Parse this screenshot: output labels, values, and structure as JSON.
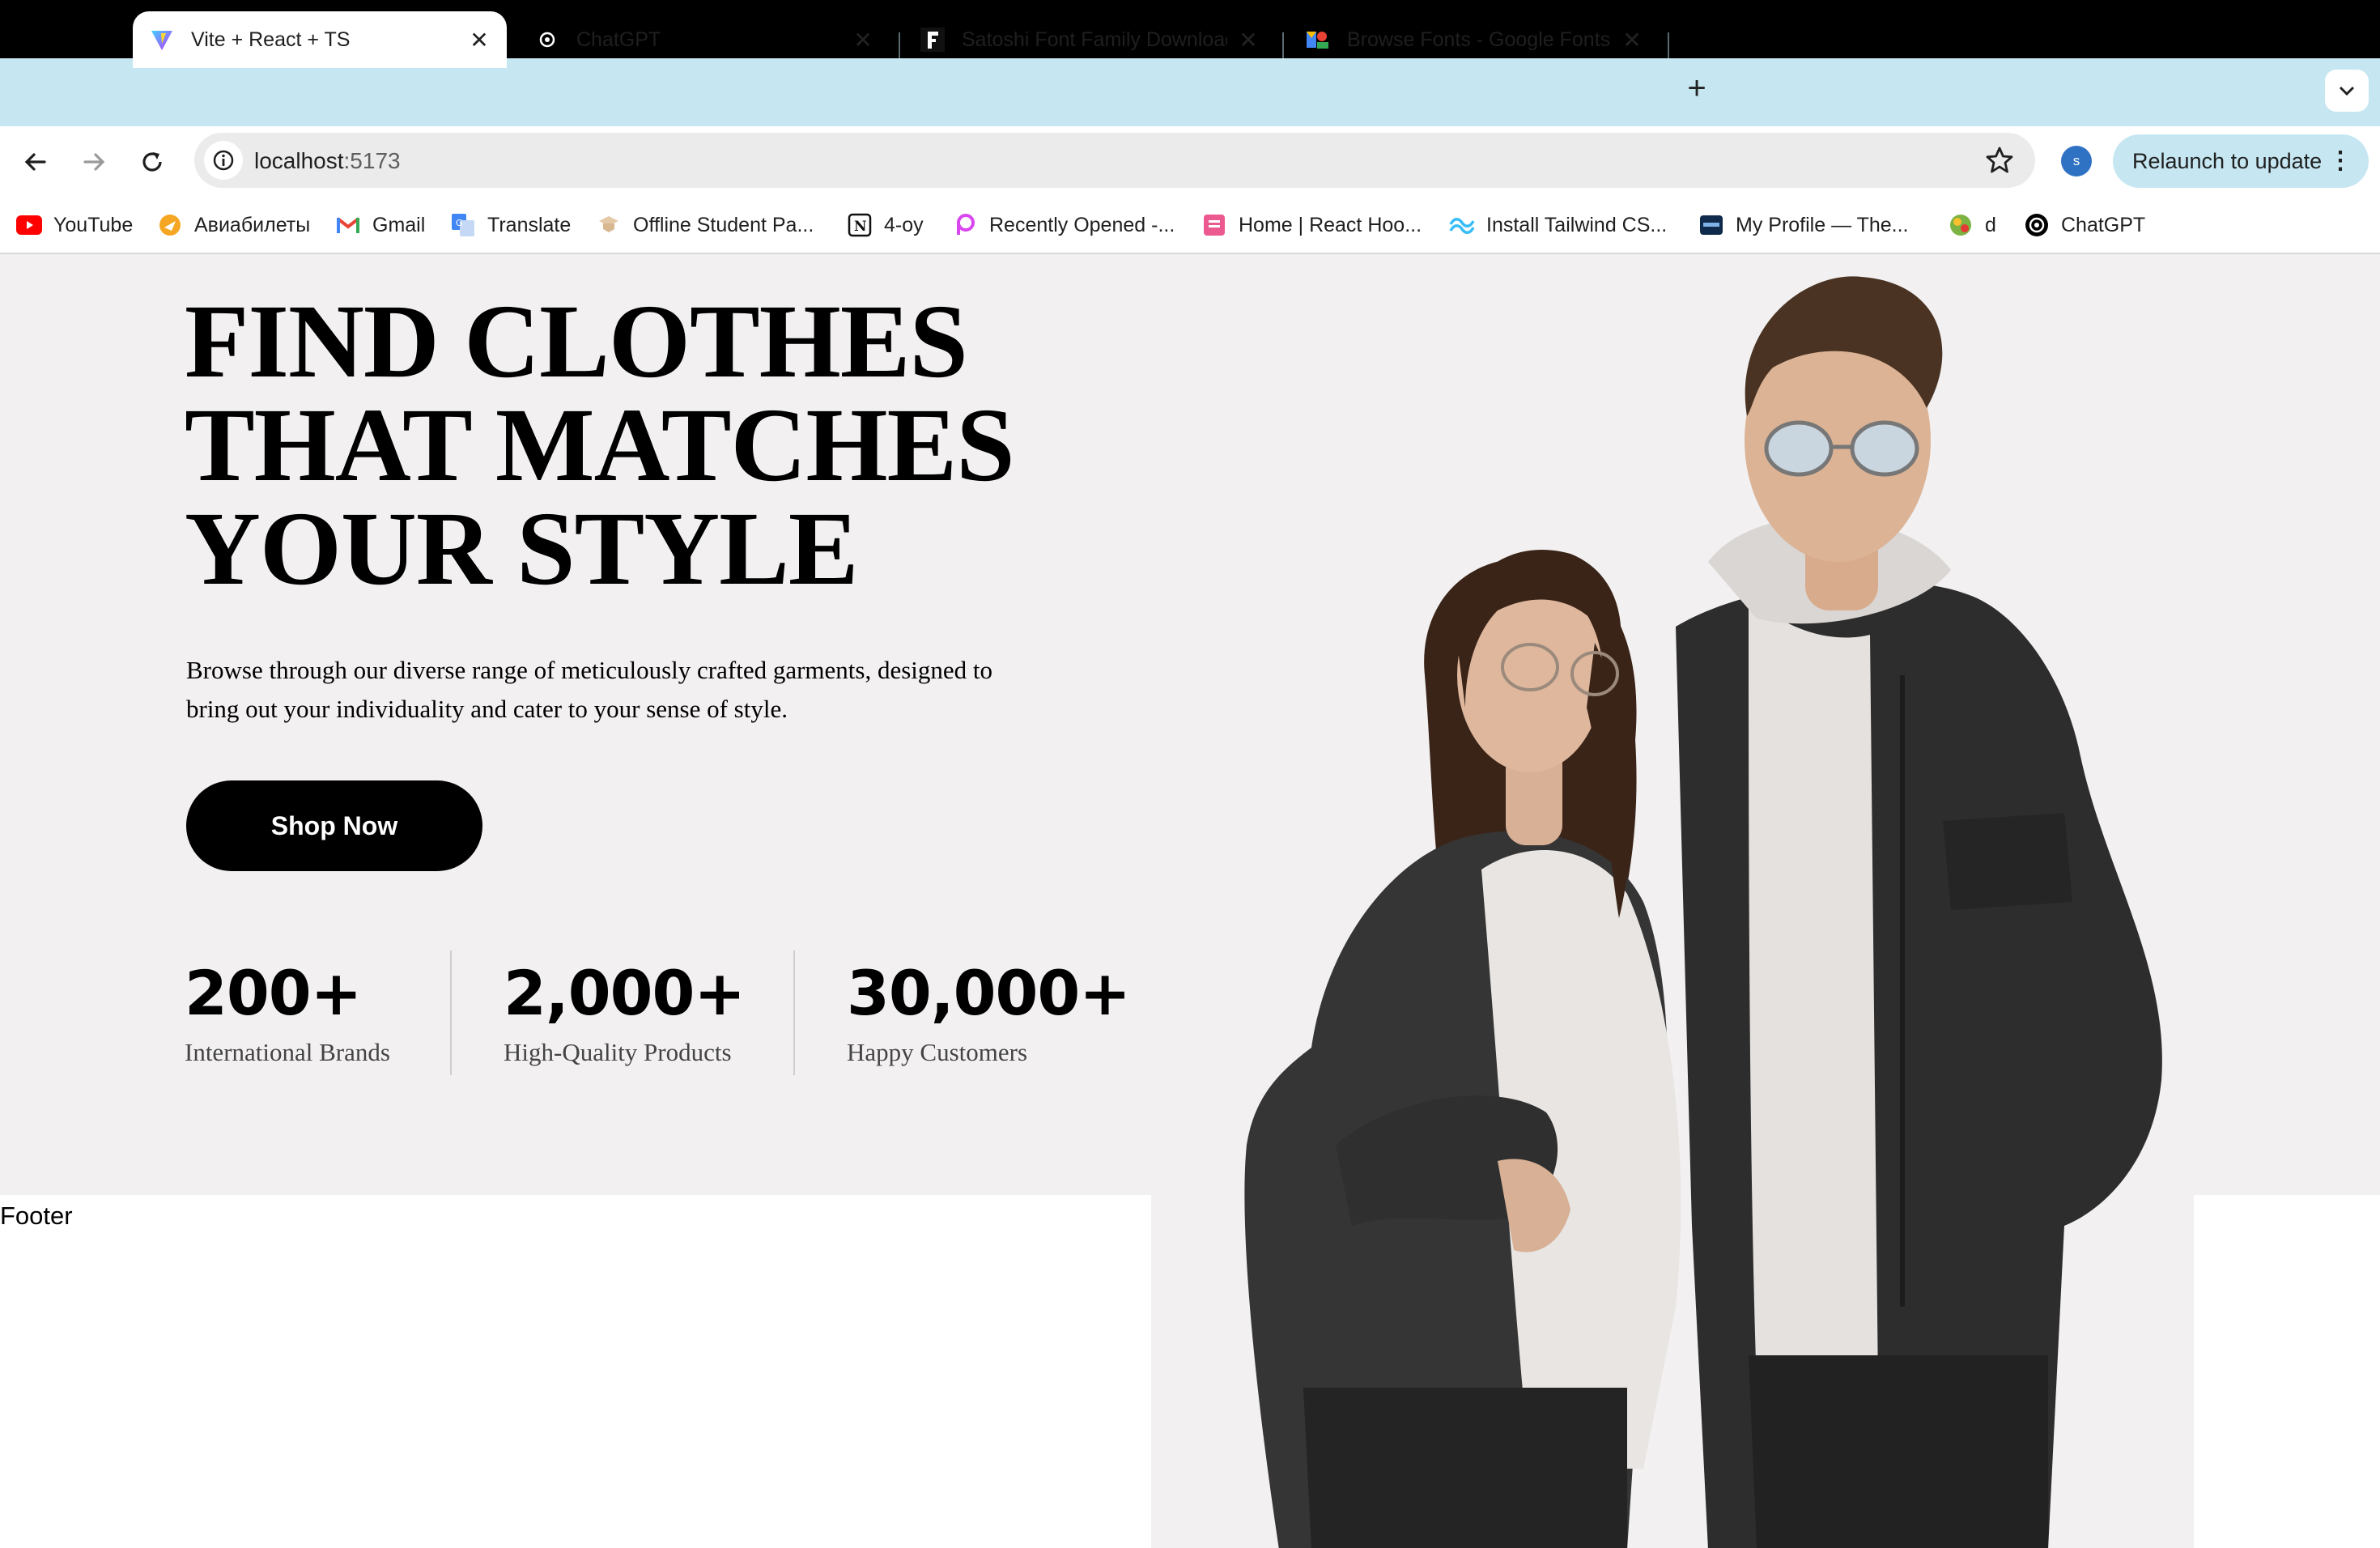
{
  "browser": {
    "tabs": [
      {
        "title": "Vite + React + TS",
        "icon": "vite-icon",
        "active": true
      },
      {
        "title": "ChatGPT",
        "icon": "openai-icon",
        "active": false
      },
      {
        "title": "Satoshi Font Family Download",
        "icon": "fontshare-icon",
        "active": false
      },
      {
        "title": "Browse Fonts - Google Fonts",
        "icon": "google-fonts-icon",
        "active": false
      }
    ],
    "url_host": "localhost",
    "url_port": ":5173",
    "profile_initial": "s",
    "relaunch_label": "Relaunch to update",
    "bookmarks": [
      {
        "label": "YouTube",
        "icon": "youtube-icon"
      },
      {
        "label": "Авиабилеты",
        "icon": "aviasales-icon"
      },
      {
        "label": "Gmail",
        "icon": "gmail-icon"
      },
      {
        "label": "Translate",
        "icon": "translate-icon"
      },
      {
        "label": "Offline Student Pa...",
        "icon": "student-icon"
      },
      {
        "label": "4-oy",
        "icon": "notion-icon"
      },
      {
        "label": "Recently Opened -...",
        "icon": "picsart-icon"
      },
      {
        "label": "Home | React Hoo...",
        "icon": "react-hook-form-icon"
      },
      {
        "label": "Install Tailwind CS...",
        "icon": "tailwind-icon"
      },
      {
        "label": "My Profile — The...",
        "icon": "profile-icon"
      },
      {
        "label": "d",
        "icon": "globe-icon"
      },
      {
        "label": "ChatGPT",
        "icon": "openai-icon"
      }
    ]
  },
  "hero": {
    "title_lines": [
      "FIND CLOTHES",
      "THAT MATCHES",
      "YOUR STYLE"
    ],
    "description_line1": "Browse through our diverse range of meticulously crafted garments, designed to",
    "description_line2": "bring out your individuality and cater to your sense of style.",
    "cta_label": "Shop Now",
    "stats": [
      {
        "value": "200+",
        "label": "International Brands"
      },
      {
        "value": "2,000+",
        "label": "High-Quality Products"
      },
      {
        "value": "30,000+",
        "label": "Happy Customers"
      }
    ]
  },
  "footer": {
    "label": "Footer"
  },
  "colors": {
    "tab_strip": "#c6e7f2",
    "hero_bg": "#f2f0f1",
    "cta_bg": "#000000"
  }
}
